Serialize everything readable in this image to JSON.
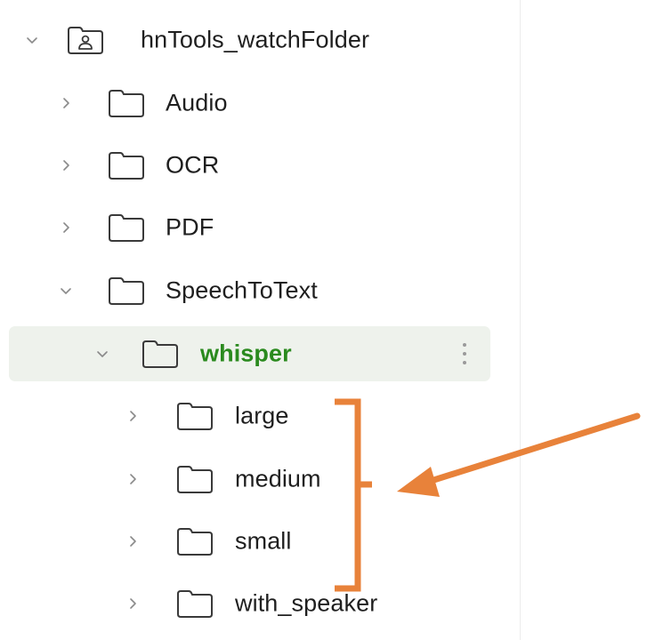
{
  "tree": {
    "root": {
      "label": "hnTools_watchFolder",
      "expanded": true,
      "icon": "shared-folder-icon"
    },
    "items": [
      {
        "label": "Audio",
        "expanded": false,
        "icon": "folder-icon"
      },
      {
        "label": "OCR",
        "expanded": false,
        "icon": "folder-icon"
      },
      {
        "label": "PDF",
        "expanded": false,
        "icon": "folder-icon"
      },
      {
        "label": "SpeechToText",
        "expanded": true,
        "icon": "folder-icon"
      },
      {
        "label": "whisper",
        "expanded": true,
        "selected": true,
        "icon": "folder-icon"
      },
      {
        "label": "large",
        "expanded": false,
        "icon": "folder-icon"
      },
      {
        "label": "medium",
        "expanded": false,
        "icon": "folder-icon"
      },
      {
        "label": "small",
        "expanded": false,
        "icon": "folder-icon"
      },
      {
        "label": "with_speaker",
        "expanded": false,
        "icon": "folder-icon"
      }
    ]
  },
  "colors": {
    "selected_bg": "#eef2ec",
    "selected_text": "#2a8a1e",
    "annotation": "#e8823a",
    "text": "#1f1f1f",
    "icon_stroke": "#3a3a3a"
  }
}
